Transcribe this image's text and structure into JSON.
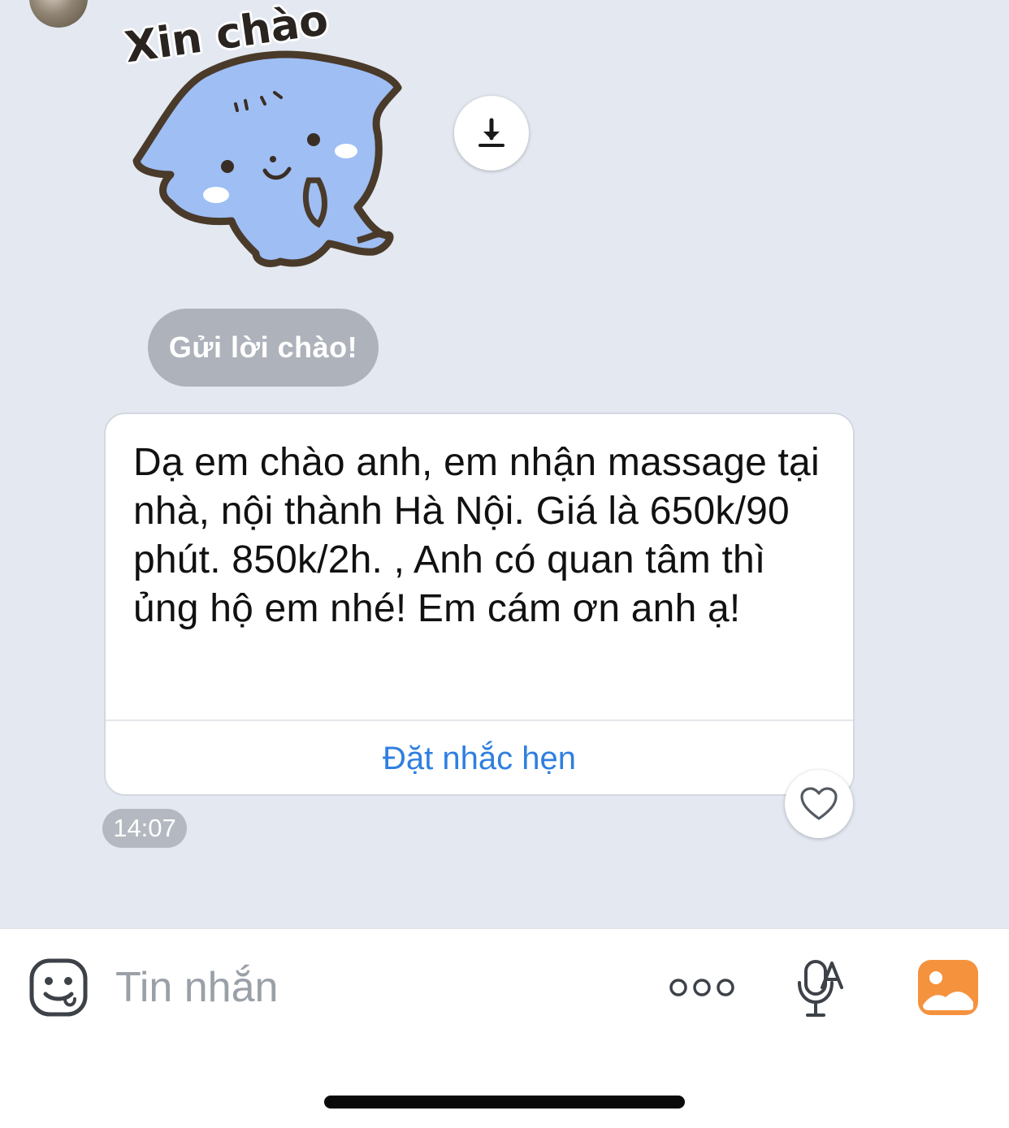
{
  "sticker": {
    "caption": "Xin chào",
    "icon": "cat-sticker"
  },
  "greet_button": {
    "label": "Gửi lời chào!"
  },
  "message": {
    "text": "Dạ em chào anh, em nhận massage tại nhà, nội thành Hà Nội. Giá là 650k/90 phút. 850k/2h. , Anh có quan tâm thì ủng hộ em nhé! Em cám ơn anh ạ!",
    "action_label": "Đặt nhắc hẹn",
    "time": "14:07"
  },
  "composer": {
    "placeholder": "Tin nhắn"
  },
  "colors": {
    "accent_blue": "#2f7fe0",
    "photo_orange": "#f5923e",
    "chat_bg": "#e3e8f1"
  }
}
